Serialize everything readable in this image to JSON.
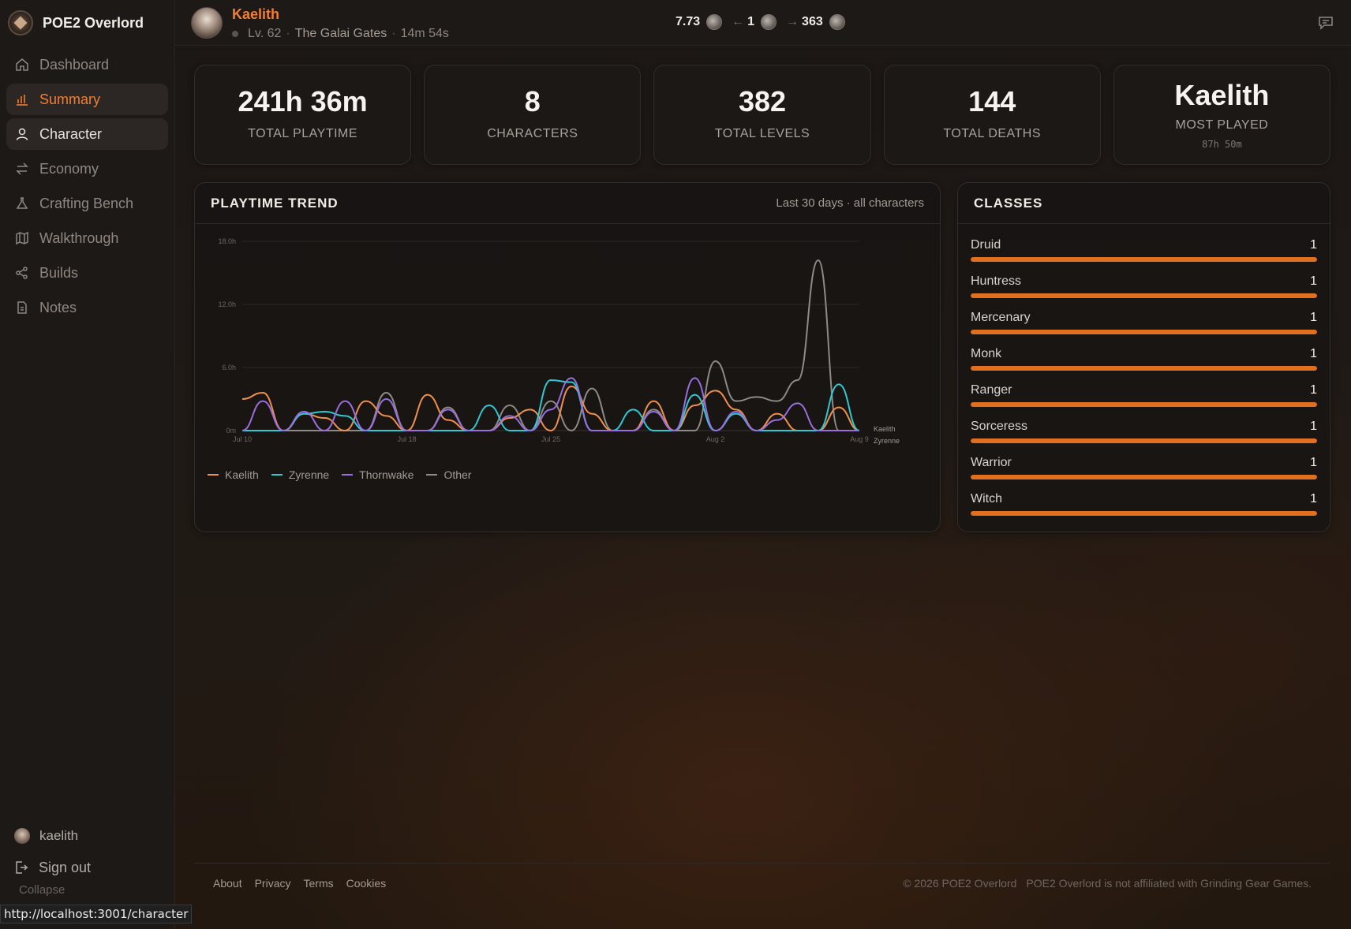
{
  "app": {
    "name": "POE2 Overlord"
  },
  "nav": {
    "items": [
      {
        "label": "Dashboard",
        "icon": "home-icon",
        "state": "normal"
      },
      {
        "label": "Summary",
        "icon": "bar-chart-icon",
        "state": "active"
      },
      {
        "label": "Character",
        "icon": "user-icon",
        "state": "hover"
      },
      {
        "label": "Economy",
        "icon": "exchange-icon",
        "state": "normal"
      },
      {
        "label": "Crafting Bench",
        "icon": "flask-icon",
        "state": "normal"
      },
      {
        "label": "Walkthrough",
        "icon": "map-icon",
        "state": "normal"
      },
      {
        "label": "Builds",
        "icon": "share-icon",
        "state": "normal"
      },
      {
        "label": "Notes",
        "icon": "document-icon",
        "state": "normal"
      }
    ],
    "username": "kaelith",
    "signout": "Sign out",
    "collapse": "Collapse"
  },
  "status_url": "http://localhost:3001/character",
  "header": {
    "char_name": "Kaelith",
    "level": "Lv. 62",
    "zone": "The Galai Gates",
    "session_time": "14m 54s",
    "currency": {
      "divine_ratio": "7.73",
      "mid": "1",
      "chaos": "363"
    }
  },
  "stats": [
    {
      "value": "241h 36m",
      "label": "TOTAL PLAYTIME"
    },
    {
      "value": "8",
      "label": "CHARACTERS"
    },
    {
      "value": "382",
      "label": "TOTAL LEVELS"
    },
    {
      "value": "144",
      "label": "TOTAL DEATHS"
    }
  ],
  "most_played": {
    "value": "Kaelith",
    "label": "MOST PLAYED",
    "sub": "87h 50m"
  },
  "trend": {
    "title": "PLAYTIME TREND",
    "subtitle": "Last 30 days · all characters"
  },
  "chart_data": {
    "type": "line",
    "x": [
      "Jul 10",
      "Jul 11",
      "Jul 12",
      "Jul 13",
      "Jul 14",
      "Jul 15",
      "Jul 16",
      "Jul 17",
      "Jul 18",
      "Jul 19",
      "Jul 20",
      "Jul 21",
      "Jul 22",
      "Jul 23",
      "Jul 24",
      "Jul 25",
      "Jul 26",
      "Jul 27",
      "Jul 28",
      "Jul 29",
      "Jul 30",
      "Jul 31",
      "Aug 1",
      "Aug 2",
      "Aug 3",
      "Aug 4",
      "Aug 5",
      "Aug 6",
      "Aug 7",
      "Aug 8",
      "Aug 9"
    ],
    "x_tick_labels": [
      "Jul 10",
      "Jul 18",
      "Jul 25",
      "Aug 2",
      "Aug 9"
    ],
    "y_tick_labels": [
      "0m",
      "6.0h",
      "12.0h",
      "18.0h"
    ],
    "ylim": [
      0,
      18
    ],
    "grid": true,
    "legend_position": "bottom-left",
    "end_labels": [
      "Kaelith",
      "Zyrenne"
    ],
    "series": [
      {
        "name": "Kaelith",
        "color": "#f0904a",
        "values": [
          3.0,
          3.6,
          0,
          1.6,
          1.2,
          0,
          2.8,
          1.4,
          0,
          3.4,
          1.0,
          0,
          0,
          1.2,
          2.0,
          0,
          4.2,
          1.6,
          0,
          0,
          2.8,
          0,
          2.4,
          3.8,
          2.0,
          0,
          1.6,
          0,
          0,
          2.2,
          0
        ]
      },
      {
        "name": "Zyrenne",
        "color": "#2fc9d3",
        "values": [
          0,
          0,
          0,
          1.6,
          1.8,
          1.4,
          0,
          0,
          0,
          0,
          0,
          0,
          2.4,
          0,
          0,
          4.8,
          4.6,
          0,
          0,
          2.0,
          0,
          0,
          3.4,
          0,
          1.6,
          0,
          0,
          0,
          0,
          4.4,
          0
        ]
      },
      {
        "name": "Thornwake",
        "color": "#9a6ee0",
        "values": [
          0,
          2.8,
          0,
          1.8,
          0,
          2.8,
          0,
          3.0,
          0,
          0,
          2.0,
          0,
          0,
          1.4,
          0,
          2.0,
          5.0,
          0,
          0,
          0,
          1.8,
          0,
          5.0,
          0,
          1.8,
          0,
          1.0,
          2.6,
          0,
          0,
          0
        ]
      },
      {
        "name": "Other",
        "color": "#8e8a86",
        "values": [
          0,
          0,
          0,
          0,
          0,
          0,
          0,
          3.6,
          0,
          0,
          2.2,
          0,
          0,
          2.4,
          0,
          2.8,
          0,
          4.0,
          0,
          0,
          2.0,
          0,
          0,
          6.6,
          2.8,
          3.2,
          2.8,
          4.8,
          16.2,
          0,
          0
        ]
      }
    ]
  },
  "classes": {
    "title": "CLASSES",
    "items": [
      {
        "name": "Druid",
        "count": "1",
        "fraction": 1
      },
      {
        "name": "Huntress",
        "count": "1",
        "fraction": 1
      },
      {
        "name": "Mercenary",
        "count": "1",
        "fraction": 1
      },
      {
        "name": "Monk",
        "count": "1",
        "fraction": 1
      },
      {
        "name": "Ranger",
        "count": "1",
        "fraction": 1
      },
      {
        "name": "Sorceress",
        "count": "1",
        "fraction": 1
      },
      {
        "name": "Warrior",
        "count": "1",
        "fraction": 1
      },
      {
        "name": "Witch",
        "count": "1",
        "fraction": 1
      }
    ]
  },
  "footer": {
    "links": [
      "About",
      "Privacy",
      "Terms",
      "Cookies"
    ],
    "copyright": "© 2026 POE2 Overlord",
    "disclaimer": "POE2 Overlord is not affiliated with Grinding Gear Games."
  },
  "colors": {
    "accent": "#ef7f33",
    "bar": "#e0701f"
  }
}
